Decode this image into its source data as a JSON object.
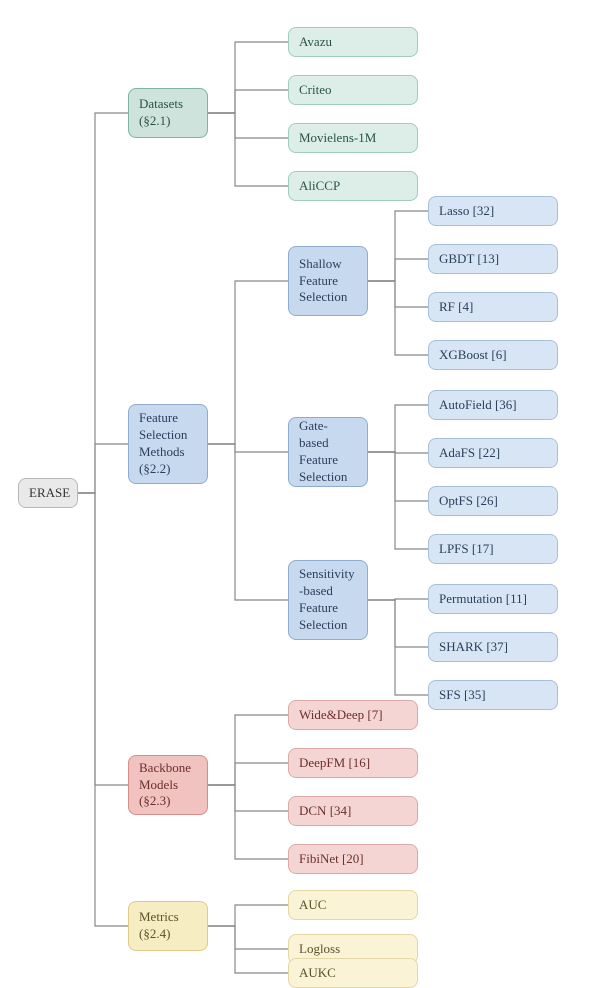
{
  "root": "ERASE",
  "datasets": {
    "label": "Datasets (§2.1)",
    "items": [
      "Avazu",
      "Criteo",
      "Movielens-1M",
      "AliCCP"
    ]
  },
  "fsm": {
    "label": "Feature Selection Methods (§2.2)",
    "shallow": {
      "label": "Shallow Feature Selection",
      "items": [
        "Lasso [32]",
        "GBDT [13]",
        "RF [4]",
        "XGBoost [6]"
      ]
    },
    "gate": {
      "label": "Gate-based Feature Selection",
      "items": [
        "AutoField [36]",
        "AdaFS [22]",
        "OptFS [26]",
        "LPFS [17]"
      ]
    },
    "sens": {
      "label": "Sensitivity-based Feature Selection",
      "items": [
        "Permutation [11]",
        "SHARK [37]",
        "SFS [35]"
      ]
    }
  },
  "backbone": {
    "label": "Backbone Models (§2.3)",
    "items": [
      "Wide&Deep [7]",
      "DeepFM [16]",
      "DCN [34]",
      "FibiNet [20]"
    ]
  },
  "metrics": {
    "label": "Metrics (§2.4)",
    "items": [
      "AUC",
      "Logloss",
      "AUKC"
    ]
  }
}
